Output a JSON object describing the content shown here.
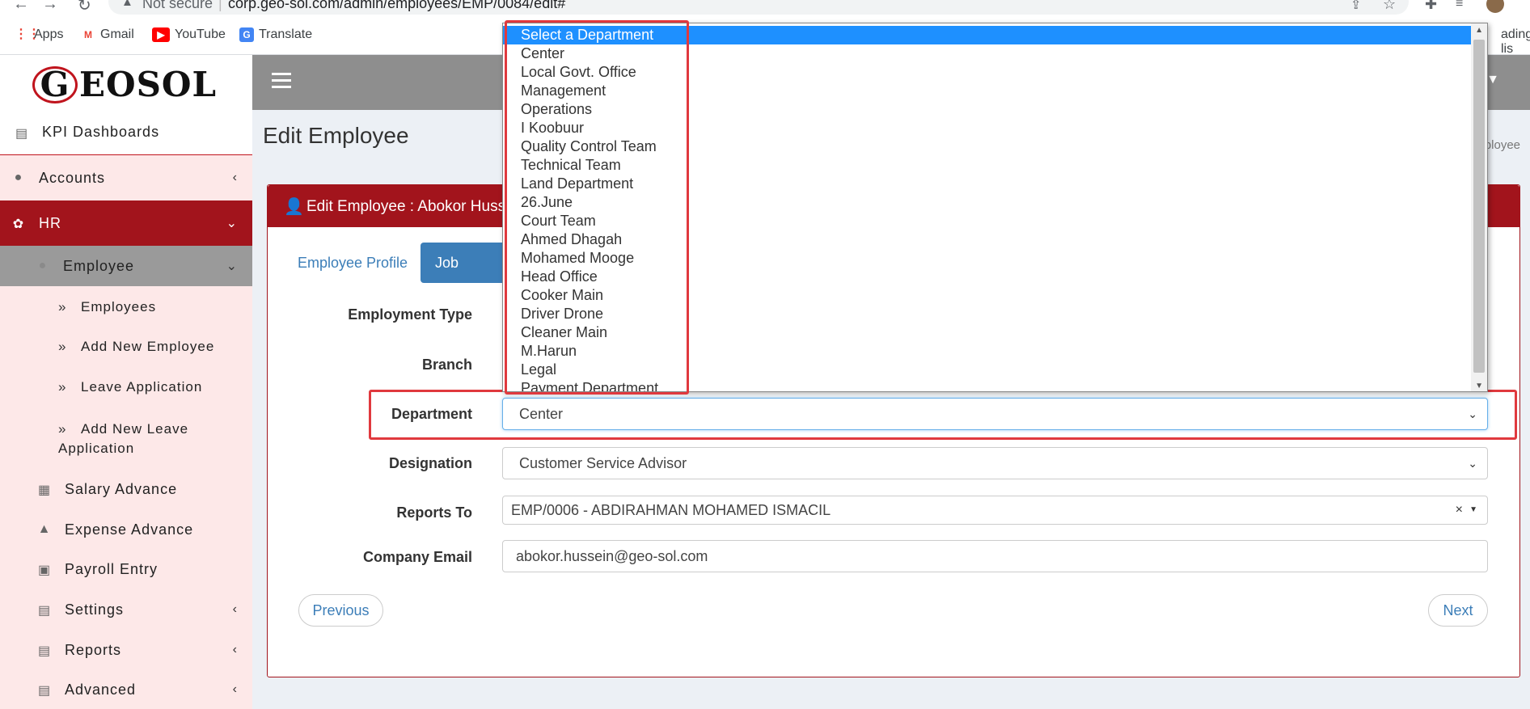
{
  "browser": {
    "url_warning": "Not secure",
    "url": "corp.geo-sol.com/admin/employees/EMP/0084/edit#",
    "bookmarks": [
      "Apps",
      "Gmail",
      "YouTube",
      "Translate"
    ],
    "bookmark_overflow": "ading lis"
  },
  "sidebar": {
    "logo": "GEOSOL",
    "items": [
      {
        "label": "KPI Dashboards",
        "icon": "book-icon"
      },
      {
        "label": "Accounts",
        "icon": "piggy-bank-icon"
      },
      {
        "label": "HR",
        "icon": "award-icon"
      },
      {
        "label": "Employee",
        "icon": "person-icon"
      }
    ],
    "employee_sub": [
      "Employees",
      "Add New Employee",
      "Leave Application",
      "Add New Leave Application"
    ],
    "bottom_items": [
      {
        "label": "Salary Advance",
        "icon": "table-icon"
      },
      {
        "label": "Expense Advance",
        "icon": "user-icon"
      },
      {
        "label": "Payroll Entry",
        "icon": "id-card-icon"
      },
      {
        "label": "Settings",
        "icon": "book-icon"
      },
      {
        "label": "Reports",
        "icon": "book-icon"
      },
      {
        "label": "Advanced",
        "icon": "book-icon"
      }
    ]
  },
  "page": {
    "title": "Edit Employee",
    "breadcrumb_tail": "ployee"
  },
  "card": {
    "title": "Edit Employee : Abokor Huss",
    "tabs": [
      "Employee Profile",
      "Job Profile"
    ]
  },
  "form": {
    "employment_type_label": "Employment Type",
    "branch_label": "Branch",
    "department_label": "Department",
    "department_value": "Center",
    "designation_label": "Designation",
    "designation_value": "Customer Service Advisor",
    "reports_to_label": "Reports To",
    "reports_to_value": "EMP/0006 - ABDIRAHMAN MOHAMED ISMACIL",
    "company_email_label": "Company Email",
    "company_email_value": "abokor.hussein@geo-sol.com"
  },
  "buttons": {
    "previous": "Previous",
    "next": "Next"
  },
  "dropdown": {
    "options": [
      "Select a Department",
      "Center",
      "Local Govt. Office",
      "Management",
      "Operations",
      "I Koobuur",
      "Quality Control Team",
      "Technical Team",
      "Land Department",
      "26.June",
      "Court Team",
      "Ahmed Dhagah",
      "Mohamed Mooge",
      "Head Office",
      "Cooker Main",
      "Driver Drone",
      "Cleaner Main",
      "M.Harun",
      "Legal",
      "Payment Department"
    ],
    "selected_index": 0
  },
  "colors": {
    "brand_red": "#a2141c",
    "accent_blue": "#3c7eb8",
    "highlight_red": "#e0393e",
    "selected_option": "#1e90ff"
  }
}
